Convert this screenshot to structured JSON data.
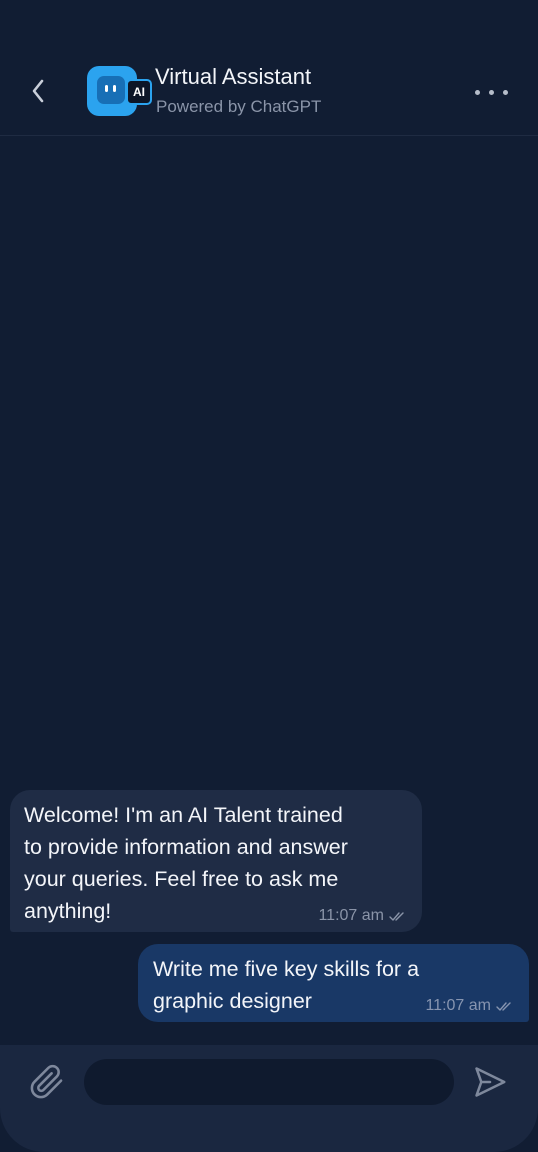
{
  "header": {
    "title": "Virtual Assistant",
    "subtitle": "Powered by ChatGPT",
    "avatar_badge": "AI",
    "back_icon": "chevron-left-icon",
    "more_icon": "more-horizontal-icon"
  },
  "messages": [
    {
      "direction": "incoming",
      "lines": [
        "Welcome! I'm an AI Talent trained",
        "to provide information and answer",
        "your queries. Feel free to ask me",
        "anything!"
      ],
      "time": "11:07 am",
      "status_icon": "double-check-icon"
    },
    {
      "direction": "outgoing",
      "lines": [
        "Write me five key skills for a",
        "graphic designer"
      ],
      "time": "11:07 am",
      "status_icon": "double-check-icon"
    }
  ],
  "composer": {
    "placeholder": "",
    "attach_icon": "paperclip-icon",
    "send_icon": "send-icon"
  },
  "colors": {
    "background": "#111d33",
    "incoming_bubble": "#1f2c45",
    "outgoing_bubble": "#193866",
    "composer": "#1a2740",
    "accent": "#2ba3ef"
  }
}
